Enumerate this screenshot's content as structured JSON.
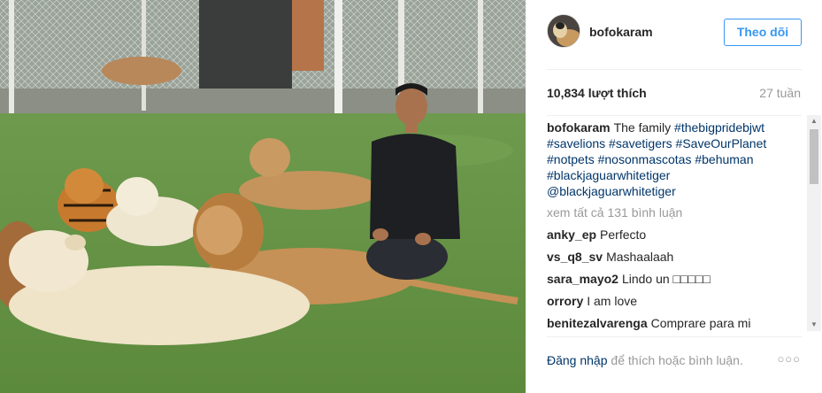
{
  "post": {
    "username": "bofokaram",
    "follow_label": "Theo dõi",
    "likes": "10,834 lượt thích",
    "time_ago": "27 tuần",
    "caption": {
      "user": "bofokaram",
      "text": "The family",
      "hashtags": [
        "#thebigpridebjwt",
        "#savelions",
        "#savetigers",
        "#SaveOurPlanet",
        "#notpets",
        "#nosonmascotas",
        "#behuman",
        "#blackjaguarwhitetiger",
        "@blackjaguarwhitetiger"
      ]
    },
    "view_all_comments": "xem tất cả 131 bình luận",
    "comments": [
      {
        "user": "anky_ep",
        "text": "Perfecto"
      },
      {
        "user": "vs_q8_sv",
        "text": "Mashaalaah"
      },
      {
        "user": "sara_mayo2",
        "text": "Lindo un □□□□□"
      },
      {
        "user": "orrory",
        "text": "I am love"
      },
      {
        "user": "benitezalvarenga",
        "text": "Comprare para mi"
      }
    ],
    "footer": {
      "login": "Đăng nhập",
      "prompt": "để thích hoặc bình luận.",
      "more": "○○○"
    }
  },
  "icons": {
    "more": "more-options-icon",
    "scroll_up": "scroll-up-arrow-icon",
    "scroll_down": "scroll-down-arrow-icon"
  },
  "colors": {
    "link": "#003569",
    "follow": "#3897f0",
    "muted": "#999999",
    "text": "#262626"
  }
}
